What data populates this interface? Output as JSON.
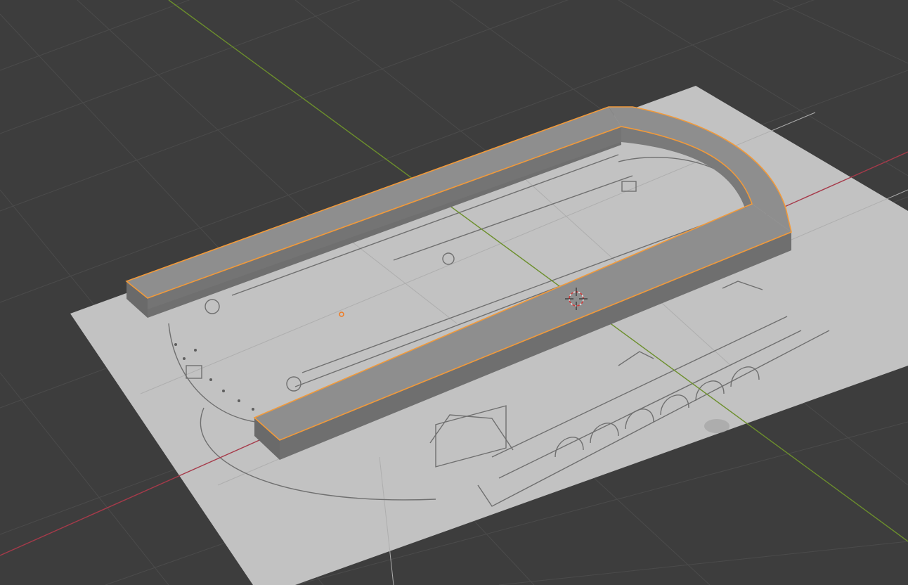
{
  "viewport": {
    "mode": "3d-viewport",
    "object_selected": true,
    "colors": {
      "background": "#3d3d3d",
      "grid": "#4a4a4a",
      "axis_x": "#a63a4a",
      "axis_y": "#6c8f2c",
      "selection_outline": "#f29a3a",
      "wall_top": "#8c8c8c",
      "wall_side": "#6e6e6e",
      "wall_front": "#7e7e7e",
      "reference_plane": "#c4c4c4",
      "sketch_lines": "#6a6a6a"
    }
  },
  "scene": {
    "objects": [
      {
        "name": "reference-image-plane",
        "icon": "image-plane"
      },
      {
        "name": "wall-mesh",
        "icon": "mesh",
        "selected": true
      },
      {
        "name": "3d-cursor",
        "icon": "cursor-crosshair"
      },
      {
        "name": "object-origin",
        "icon": "origin-dot"
      }
    ]
  }
}
